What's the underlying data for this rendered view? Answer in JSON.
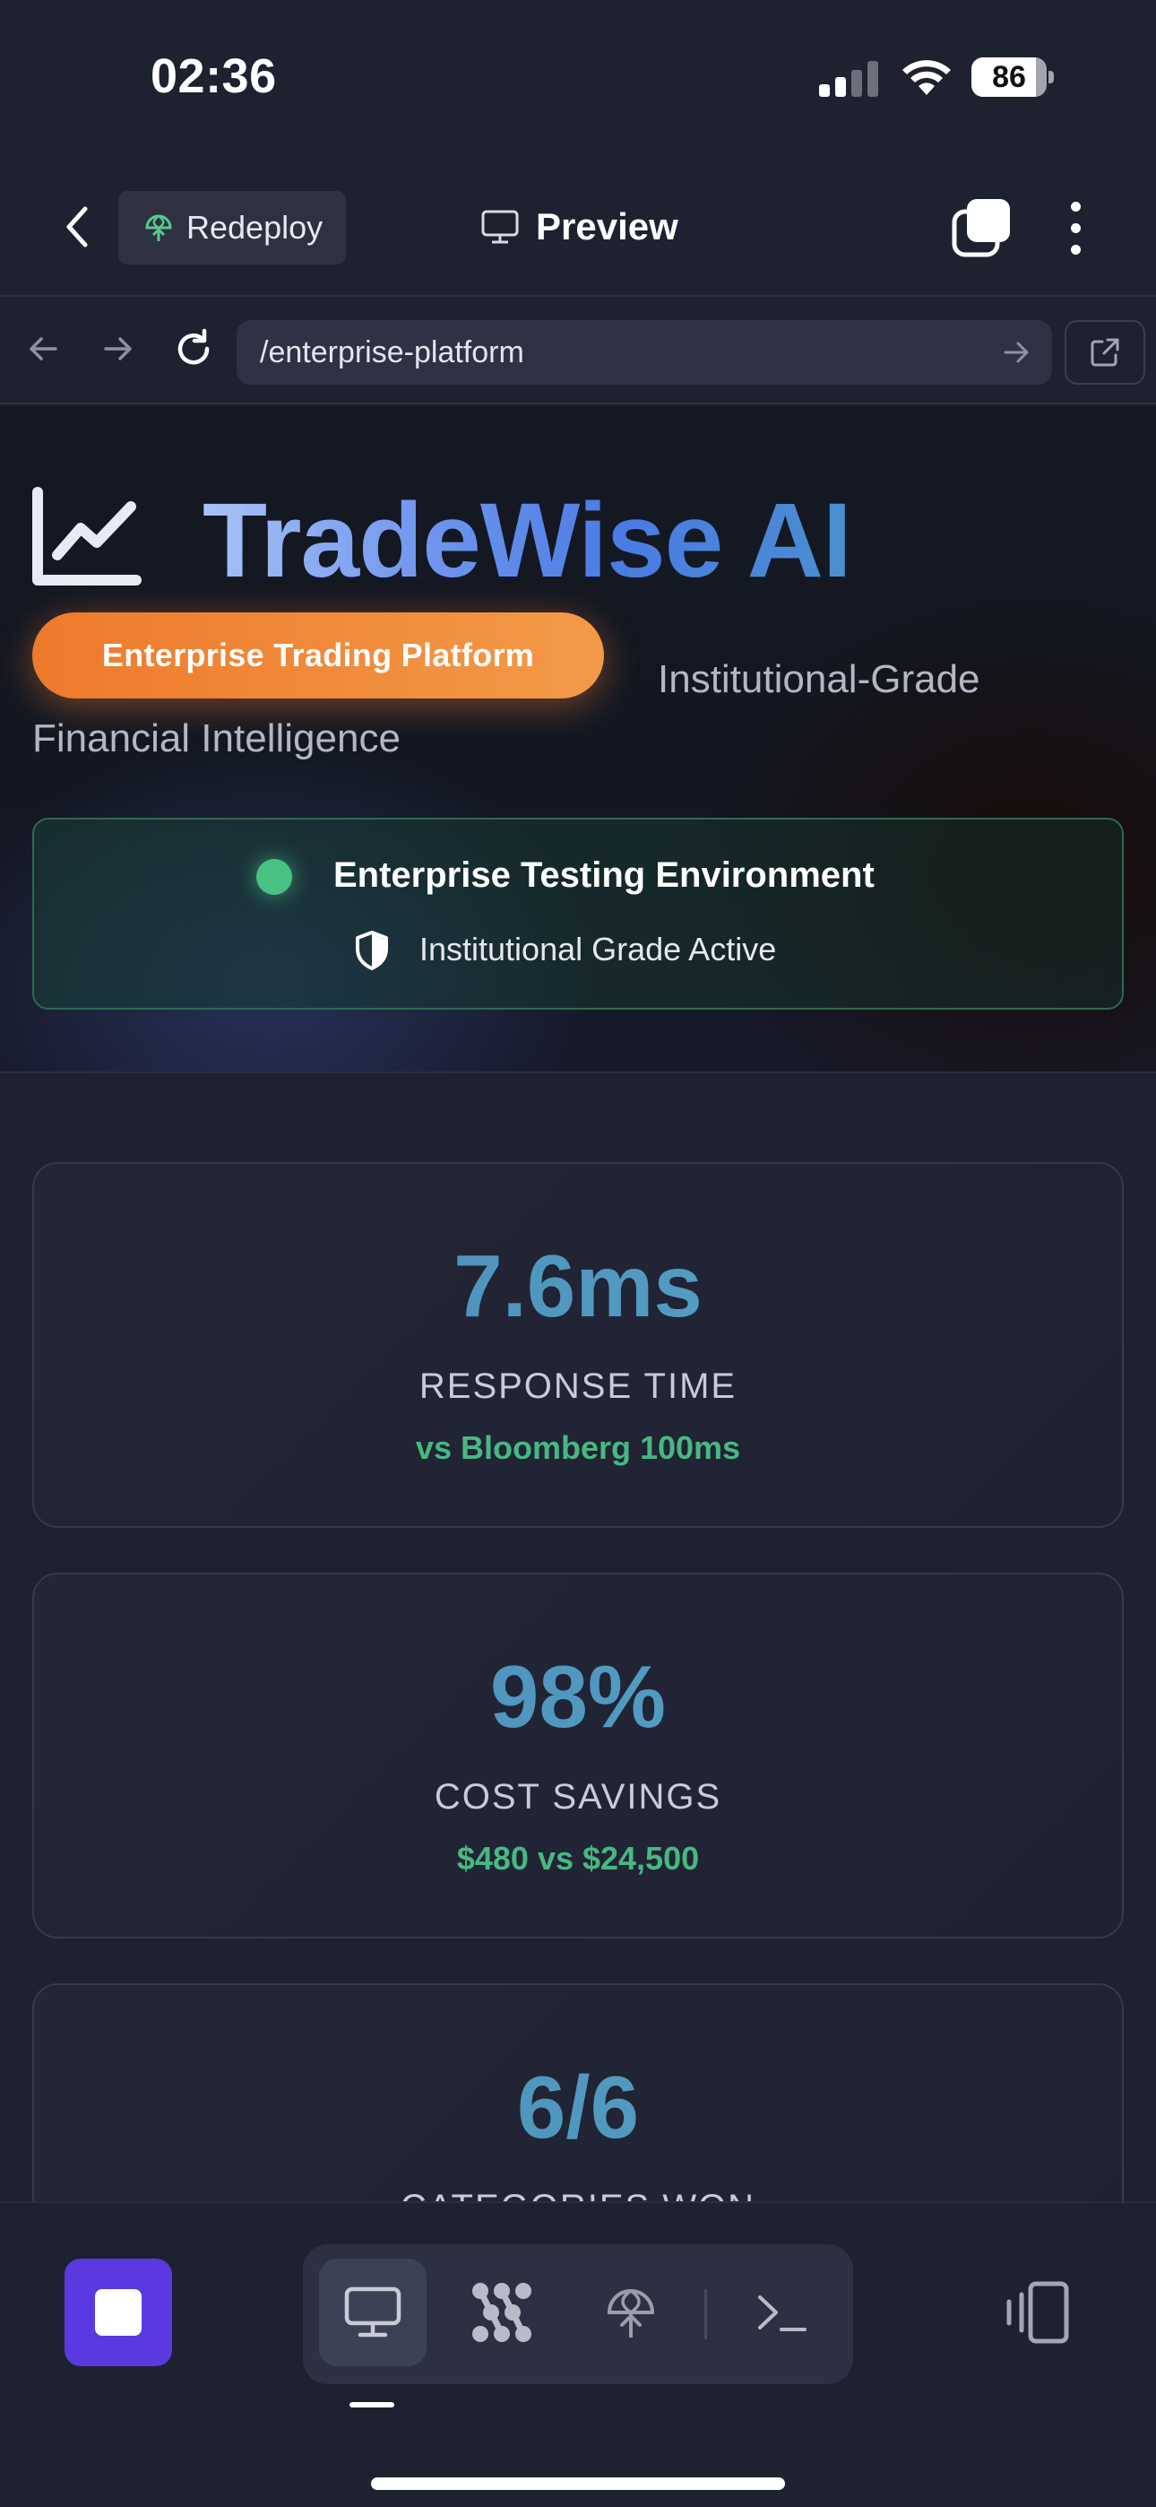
{
  "status_bar": {
    "time": "02:36",
    "battery": "86",
    "battery_fraction": 0.86
  },
  "header": {
    "redeploy_label": "Redeploy",
    "title": "Preview"
  },
  "browser": {
    "url": "/enterprise-platform"
  },
  "hero": {
    "brand": "TradeWise AI",
    "badge": "Enterprise Trading Platform",
    "subtitle_line1": "Institutional-Grade",
    "subtitle_line2": "Financial Intelligence",
    "environment_title": "Enterprise Testing Environment",
    "environment_status": "Institutional Grade Active"
  },
  "metrics": [
    {
      "value": "7.6ms",
      "label": "RESPONSE TIME",
      "compare": "vs Bloomberg 100ms"
    },
    {
      "value": "98%",
      "label": "COST SAVINGS",
      "compare": "$480 vs $24,500"
    },
    {
      "value": "6/6",
      "label": "CATEGORIES WON"
    }
  ],
  "colors": {
    "background": "#1e2130",
    "accent_orange": "#ee7a2c",
    "accent_blue": "#4a7be3",
    "success_green": "#47b881",
    "stop_purple": "#5a3ae0"
  },
  "icons": {
    "back": "chevron-left-icon",
    "redeploy": "globe-deploy-icon",
    "preview": "monitor-icon",
    "tabs": "tabs-icon",
    "more": "more-vertical-icon",
    "nav_back": "arrow-left-icon",
    "nav_forward": "arrow-right-icon",
    "reload": "reload-icon",
    "url_go": "arrow-right-icon",
    "external": "external-link-icon",
    "logo": "line-chart-icon",
    "shield": "shield-icon",
    "stop": "stop-icon",
    "tool_preview": "monitor-icon",
    "tool_workflows": "workflow-icon",
    "tool_deploy": "globe-deploy-icon",
    "tool_terminal": "terminal-icon",
    "devices": "devices-icon"
  }
}
